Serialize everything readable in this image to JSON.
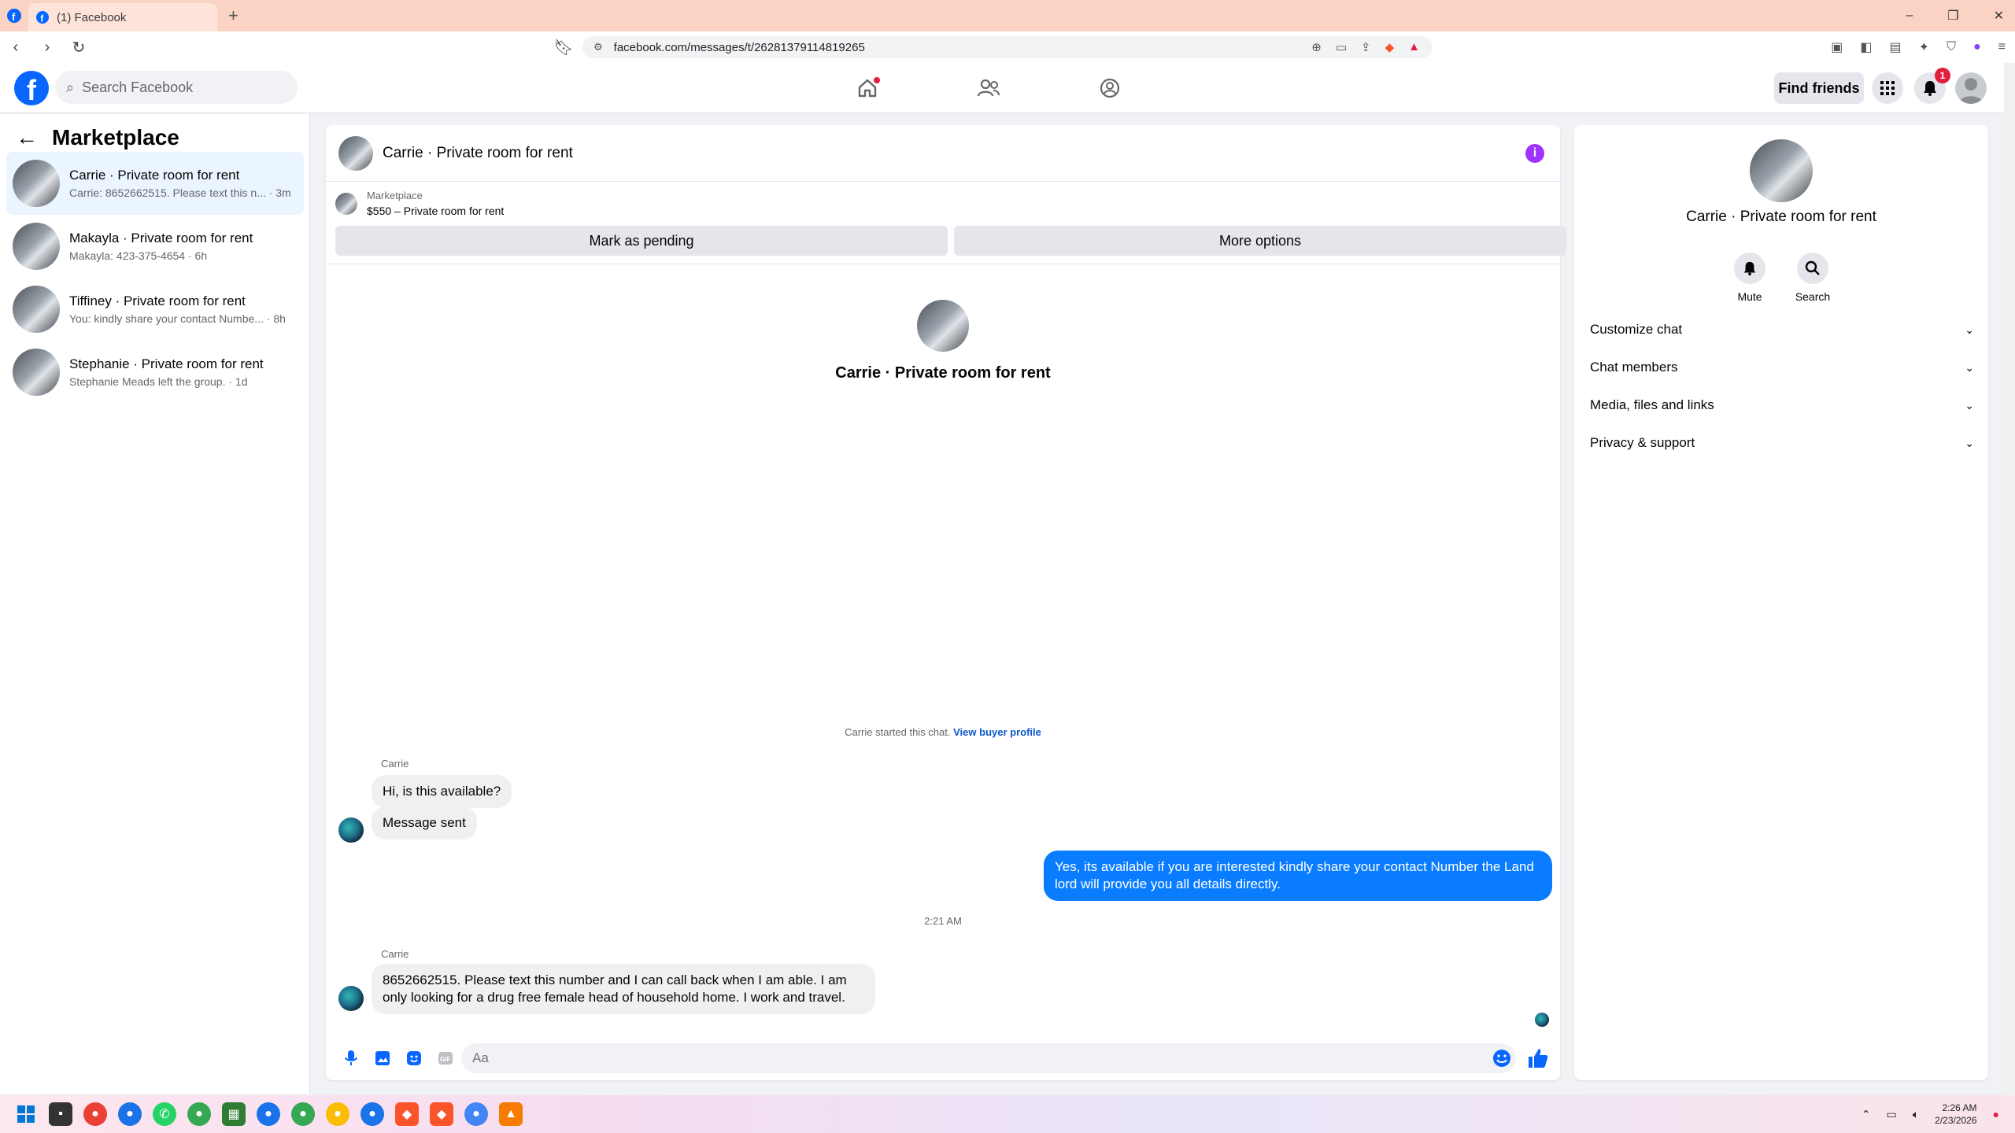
{
  "browser": {
    "tab_title": "(1) Facebook",
    "new_tab": "+",
    "url": "facebook.com/messages/t/26281379114819265",
    "win_min": "–",
    "win_max": "❐",
    "win_close": "✕"
  },
  "header": {
    "search_placeholder": "Search Facebook",
    "find_friends": "Find friends",
    "notification_count": "1"
  },
  "sidebar": {
    "title": "Marketplace",
    "conversations": [
      {
        "name": "Carrie · Private room for rent",
        "snippet": "Carrie: 8652662515. Please text this n... · 3m"
      },
      {
        "name": "Makayla · Private room for rent",
        "snippet": "Makayla: 423-375-4654 · 6h"
      },
      {
        "name": "Tiffiney · Private room for rent",
        "snippet": "You: kindly share your contact Numbe... · 8h"
      },
      {
        "name": "Stephanie · Private room for rent",
        "snippet": "Stephanie Meads left the group. · 1d"
      }
    ]
  },
  "chat": {
    "title": "Carrie · Private room for rent",
    "marketplace_label": "Marketplace",
    "listing": "$550 – Private room for rent",
    "mark_pending": "Mark as pending",
    "more_options": "More options",
    "intro_name": "Carrie · Private room for rent",
    "started_text": "Carrie started this chat.",
    "view_buyer_profile": "View buyer profile",
    "messages": {
      "sender1": "Carrie",
      "m1": "Hi, is this available?",
      "m2": "Message sent",
      "m3": "Yes, its available if you are interested kindly share your contact Number the Land lord will provide you all details directly.",
      "time": "2:21 AM",
      "sender2": "Carrie",
      "m4": "8652662515. Please text this number and I can call back when I am able. I am only looking for a drug free female head of household home. I work and travel."
    },
    "input_placeholder": "Aa"
  },
  "info_panel": {
    "name": "Carrie · Private room for rent",
    "mute": "Mute",
    "search": "Search",
    "sections": [
      "Customize chat",
      "Chat members",
      "Media, files and links",
      "Privacy & support"
    ]
  },
  "taskbar": {
    "time": "2:26 AM",
    "date": "2/23/2026"
  },
  "colors": {
    "fb_blue": "#0866ff",
    "outgoing_bubble": "#0a7cff",
    "active_conv": "#ebf5ff",
    "info_purple": "#a033ff"
  }
}
